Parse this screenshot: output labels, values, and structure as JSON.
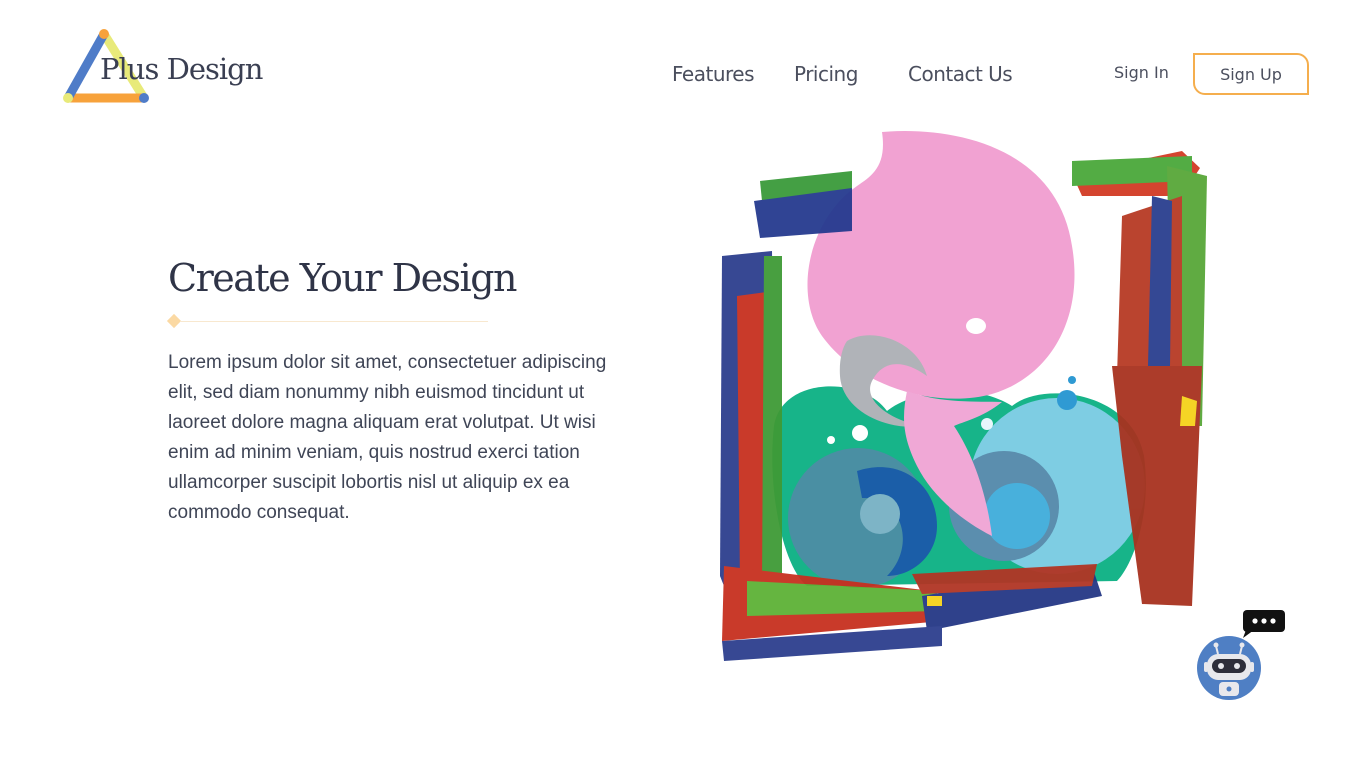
{
  "brand": {
    "name": "Plus Design",
    "colors": {
      "blue": "#4f7cc8",
      "orange": "#f7a23b",
      "yellow": "#e8ea7a"
    }
  },
  "nav": {
    "items": [
      {
        "label": "Features"
      },
      {
        "label": "Pricing"
      },
      {
        "label": "Contact Us"
      }
    ],
    "sign_in": "Sign In",
    "sign_up": "Sign Up",
    "accent_color": "#f5ae4d"
  },
  "hero": {
    "title": "Create Your Design",
    "body": "Lorem ipsum dolor sit amet, consectetuer adipiscing elit, sed diam nonummy nibh euismod tincidunt ut laoreet dolore magna aliquam erat volutpat. Ut wisi enim ad minim veniam, quis nostrud exerci tation ullamcorper suscipit lobortis nisl ut aliquip ex ea commodo consequat."
  },
  "illustration": {
    "icon": "painted-frame-whale-illustration"
  },
  "chat": {
    "icon": "robot-chat-icon",
    "bubble_icon": "chat-bubble-icon"
  }
}
